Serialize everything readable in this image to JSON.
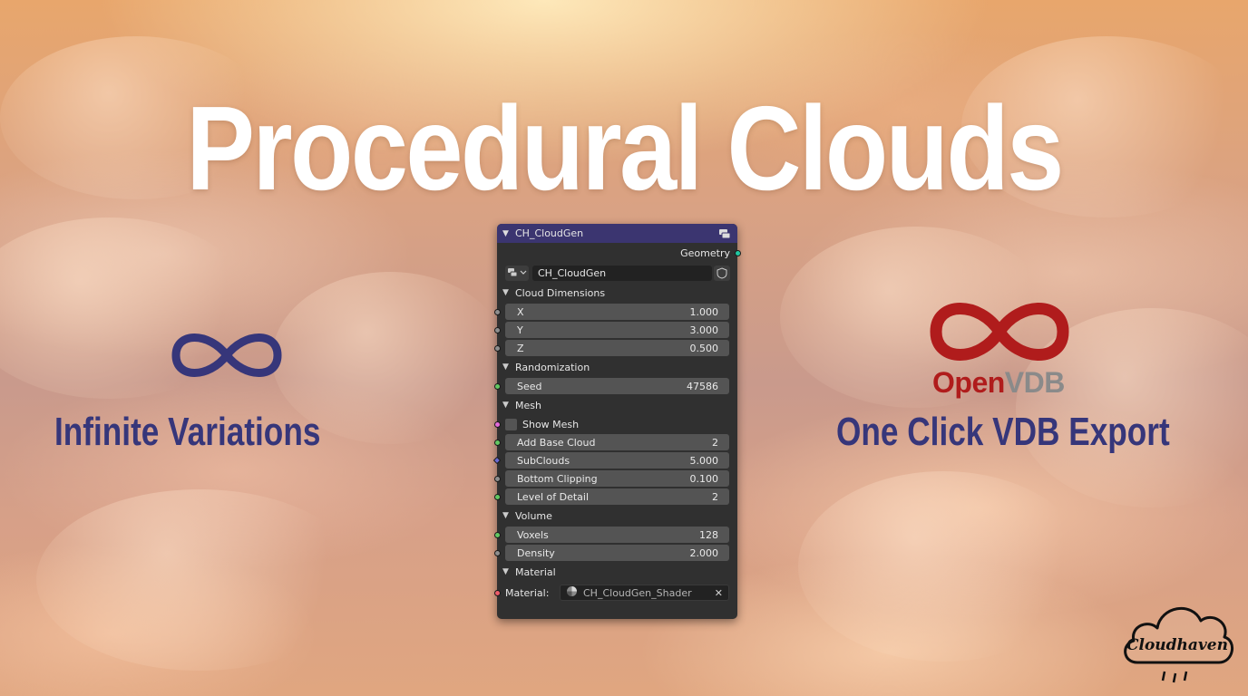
{
  "headline": "Procedural Clouds",
  "features": {
    "left": {
      "icon": "infinity-icon",
      "label": "Infinite Variations"
    },
    "right": {
      "icon": "openvdb-logo",
      "logo_open": "Open",
      "logo_vdb": "VDB",
      "label": "One Click VDB Export"
    }
  },
  "colors": {
    "accent_text": "#36367a",
    "node_header": "#3b3570",
    "vdb_red": "#b01c1c"
  },
  "node": {
    "title": "CH_CloudGen",
    "output": "Geometry",
    "group_selector": {
      "name": "CH_CloudGen"
    },
    "sections": {
      "cloud_dimensions": {
        "label": "Cloud Dimensions",
        "fields": [
          {
            "label": "X",
            "value": "1.000"
          },
          {
            "label": "Y",
            "value": "3.000"
          },
          {
            "label": "Z",
            "value": "0.500"
          }
        ]
      },
      "randomization": {
        "label": "Randomization",
        "fields": [
          {
            "label": "Seed",
            "value": "47586"
          }
        ]
      },
      "mesh": {
        "label": "Mesh",
        "show_mesh": {
          "label": "Show Mesh",
          "checked": false
        },
        "fields": [
          {
            "label": "Add Base Cloud",
            "value": "2"
          },
          {
            "label": "SubClouds",
            "value": "5.000"
          },
          {
            "label": "Bottom Clipping",
            "value": "0.100"
          },
          {
            "label": "Level of Detail",
            "value": "2"
          }
        ]
      },
      "volume": {
        "label": "Volume",
        "fields": [
          {
            "label": "Voxels",
            "value": "128"
          },
          {
            "label": "Density",
            "value": "2.000"
          }
        ]
      },
      "material": {
        "label": "Material",
        "field_label": "Material:",
        "value": "CH_CloudGen_Shader"
      }
    }
  },
  "brand": {
    "logo_text": "Cloudhaven"
  }
}
